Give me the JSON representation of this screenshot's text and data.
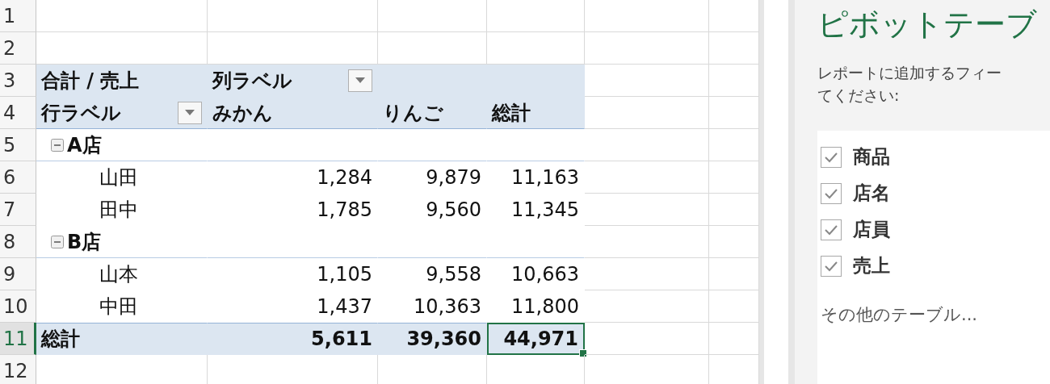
{
  "sheet": {
    "row_headers": [
      {
        "label": "1",
        "selected": false
      },
      {
        "label": "2",
        "selected": false
      },
      {
        "label": "3",
        "selected": false
      },
      {
        "label": "4",
        "selected": false
      },
      {
        "label": "5",
        "selected": false
      },
      {
        "label": "6",
        "selected": false
      },
      {
        "label": "7",
        "selected": false
      },
      {
        "label": "8",
        "selected": false
      },
      {
        "label": "9",
        "selected": false
      },
      {
        "label": "10",
        "selected": false
      },
      {
        "label": "11",
        "selected": true
      },
      {
        "label": "12",
        "selected": false
      }
    ]
  },
  "pivot": {
    "value_label": "合計 / 売上",
    "column_label": "列ラベル",
    "row_label": "行ラベル",
    "columns": [
      "みかん",
      "りんご",
      "総計"
    ],
    "rows": [
      {
        "kind": "group",
        "label": "A店",
        "expanded": true
      },
      {
        "kind": "item",
        "label": "山田",
        "values": [
          {
            "text": "1,284",
            "selected": false
          },
          {
            "text": "9,879",
            "selected": false
          },
          {
            "text": "11,163",
            "selected": false
          }
        ]
      },
      {
        "kind": "item",
        "label": "田中",
        "values": [
          {
            "text": "1,785",
            "selected": false
          },
          {
            "text": "9,560",
            "selected": false
          },
          {
            "text": "11,345",
            "selected": false
          }
        ]
      },
      {
        "kind": "group",
        "label": "B店",
        "expanded": true
      },
      {
        "kind": "item",
        "label": "山本",
        "values": [
          {
            "text": "1,105",
            "selected": false
          },
          {
            "text": "9,558",
            "selected": false
          },
          {
            "text": "10,663",
            "selected": false
          }
        ]
      },
      {
        "kind": "item",
        "label": "中田",
        "values": [
          {
            "text": "1,437",
            "selected": false
          },
          {
            "text": "10,363",
            "selected": false
          },
          {
            "text": "11,800",
            "selected": false
          }
        ]
      },
      {
        "kind": "total",
        "label": "総計",
        "values": [
          {
            "text": "5,611",
            "selected": false
          },
          {
            "text": "39,360",
            "selected": false
          },
          {
            "text": "44,971",
            "selected": true
          }
        ]
      }
    ]
  },
  "field_list": {
    "title": "ピボットテーブ",
    "description_lines": [
      "レポートに追加するフィー",
      "てください:"
    ],
    "fields": [
      {
        "label": "商品",
        "checked": true
      },
      {
        "label": "店名",
        "checked": true
      },
      {
        "label": "店員",
        "checked": true
      },
      {
        "label": "売上",
        "checked": true
      }
    ],
    "more_tables": "その他のテーブル..."
  }
}
